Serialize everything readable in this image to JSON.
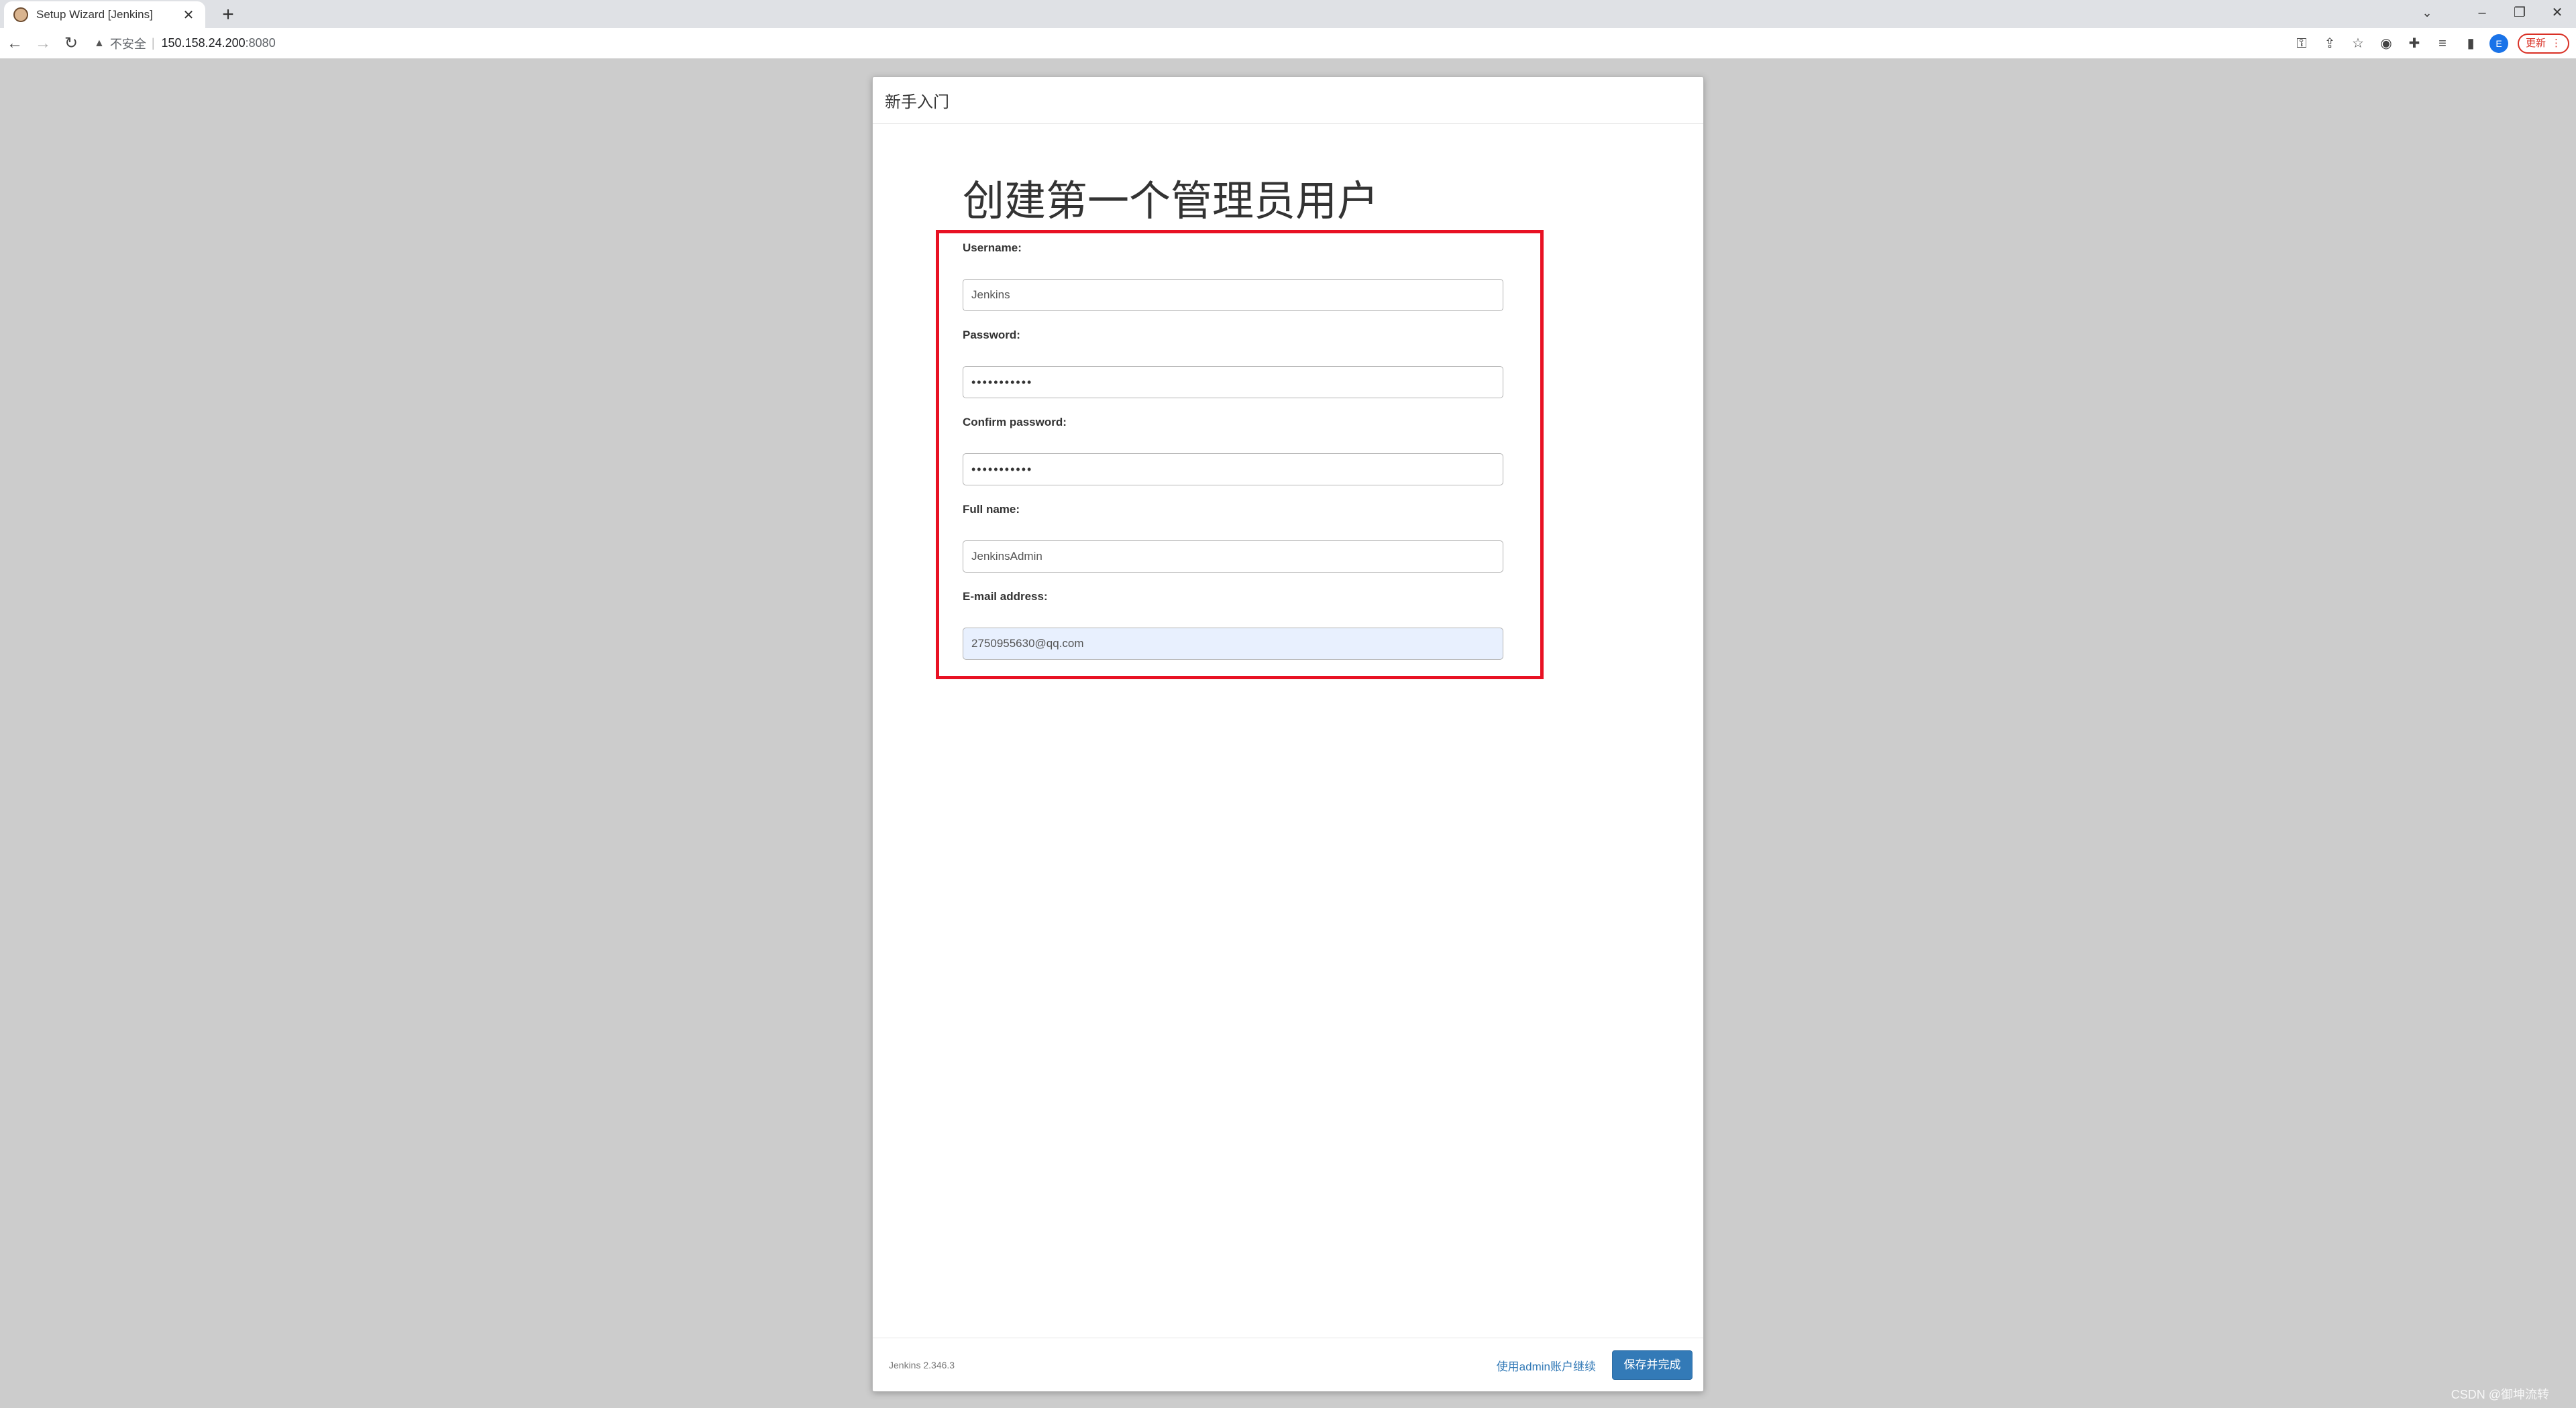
{
  "browser": {
    "tab_title": "Setup Wizard [Jenkins]",
    "tab_close": "✕",
    "new_tab": "+",
    "security_label": "不安全",
    "url_host": "150.158.24.200",
    "url_port": ":8080",
    "update_label": "更新",
    "profile_initial": "E"
  },
  "dialog": {
    "header": "新手入门",
    "title": "创建第一个管理员用户",
    "fields": [
      {
        "label": "Username:",
        "value": "Jenkins"
      },
      {
        "label": "Password:",
        "value": "•••••••••••"
      },
      {
        "label": "Confirm password:",
        "value": "•••••••••••"
      },
      {
        "label": "Full name:",
        "value": "JenkinsAdmin"
      },
      {
        "label": "E-mail address:",
        "value": "2750955630@qq.com"
      }
    ],
    "footer": {
      "version": "Jenkins 2.346.3",
      "continue_as_admin": "使用admin账户继续",
      "save_finish": "保存并完成"
    }
  },
  "watermark": "CSDN @御坤流转",
  "colors": {
    "highlight": "#e81123",
    "primary": "#337ab7",
    "autofill": "#e8f0fe"
  }
}
